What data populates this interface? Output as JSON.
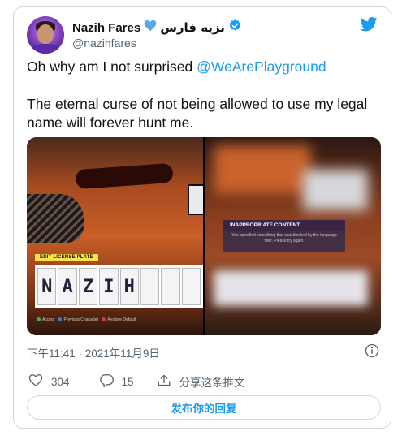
{
  "author": {
    "display_name": "Nazih Fares",
    "arabic_name": "نزيه فارس",
    "handle": "@nazihfares"
  },
  "tweet": {
    "line1_text": "Oh why am I not surprised ",
    "line1_mention": "@WeArePlayground",
    "line2": "The eternal curse of not being allowed to use my legal name will forever hunt me."
  },
  "media": {
    "left": {
      "edit_label": "EDIT LICENSE PLATE",
      "plate_letters": [
        "N",
        "A",
        "Z",
        "I",
        "H",
        "",
        "",
        ""
      ],
      "hints": [
        "Accept",
        "Previous Character",
        "Restore Default"
      ]
    },
    "right": {
      "dialog_title": "INAPPROPRIATE CONTENT",
      "dialog_body": "You specified something that was blocked by the language filter. Please try again."
    }
  },
  "meta": {
    "timestamp": "下午11:41 · 2021年11月9日"
  },
  "actions": {
    "likes": "304",
    "replies": "15",
    "share_label": "分享这条推文"
  },
  "reply_button_label": "发布你的回复",
  "colors": {
    "accent": "#1d9bf0",
    "secondary_text": "#536471",
    "border": "#cfd9de"
  }
}
